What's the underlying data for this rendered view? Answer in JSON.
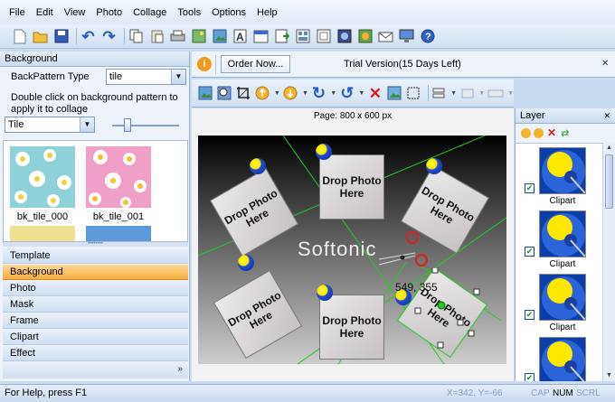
{
  "menu": [
    "File",
    "Edit",
    "View",
    "Photo",
    "Collage",
    "Tools",
    "Options",
    "Help"
  ],
  "toolbar_icons": [
    "new-icon",
    "open-icon",
    "save-icon",
    "undo-icon",
    "redo-icon",
    "copy-icon",
    "paste-icon",
    "print-icon",
    "image-icon",
    "image-add-icon",
    "text-icon",
    "calendar-icon",
    "export-icon",
    "template-icon",
    "frame-icon",
    "mask-icon",
    "clipart-icon",
    "email-icon",
    "monitor-icon",
    "help-icon"
  ],
  "left_panel": {
    "title": "Background",
    "backpattern_label": "BackPattern Type",
    "backpattern_value": "tile",
    "hint": "Double click on background pattern to apply it to collage",
    "tile_select": "Tile",
    "slider_level": 0.18,
    "thumbs": [
      "bk_tile_000",
      "bk_tile_001"
    ],
    "categories": [
      "Template",
      "Background",
      "Photo",
      "Mask",
      "Frame",
      "Clipart",
      "Effect"
    ],
    "active_category": "Background"
  },
  "notice": {
    "order_button": "Order Now...",
    "text": "Trial Version(15 Days Left)"
  },
  "canvas": {
    "page_label": "Page: 800 x 600 px",
    "placeholder": "Drop Photo Here",
    "watermark": "Softonic",
    "coords": "549, 355"
  },
  "layer_panel": {
    "title": "Layer",
    "items": [
      {
        "label": "Clipart",
        "checked": true
      },
      {
        "label": "Clipart",
        "checked": true
      },
      {
        "label": "Clipart",
        "checked": true
      },
      {
        "label": "",
        "checked": true
      }
    ]
  },
  "status": {
    "help": "For Help, press F1",
    "coords": "X=342, Y=-66",
    "cap": "CAP",
    "num": "NUM",
    "scrl": "SCRL"
  },
  "colors": {
    "accent_orange": "#f5ad3e",
    "panel_blue": "#c9dbf0",
    "delete_red": "#d42020"
  }
}
